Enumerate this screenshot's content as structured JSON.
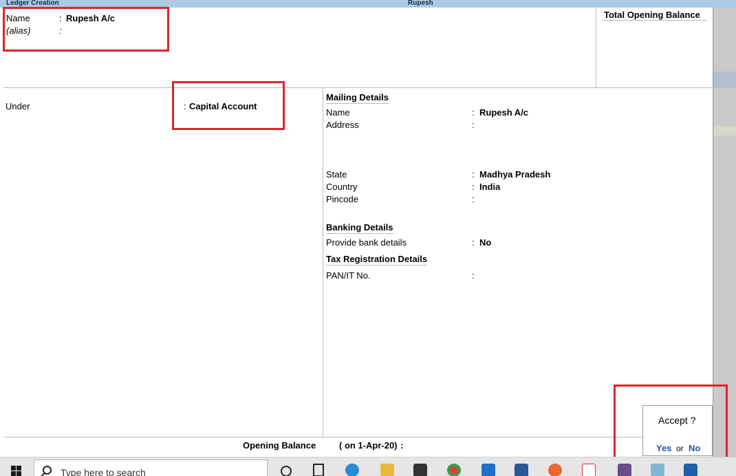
{
  "window": {
    "title": "Ledger Creation",
    "company": "Rupesh"
  },
  "ledger": {
    "name_label": "Name",
    "name_value": "Rupesh A/c",
    "alias_label": "(alias)",
    "under_label": "Under",
    "under_value": "Capital Account",
    "colon": ":"
  },
  "total_opening_balance": {
    "label": "Total Opening Balance"
  },
  "mailing": {
    "heading": "Mailing Details",
    "name_label": "Name",
    "name_value": "Rupesh A/c",
    "address_label": "Address",
    "state_label": "State",
    "state_value": "Madhya Pradesh",
    "country_label": "Country",
    "country_value": "India",
    "pincode_label": "Pincode"
  },
  "banking": {
    "heading": "Banking Details",
    "provide_label": "Provide bank details",
    "provide_value": "No"
  },
  "tax": {
    "heading": "Tax Registration Details",
    "pan_label": "PAN/IT No."
  },
  "opening_balance": {
    "label": "Opening Balance",
    "date": "( on 1-Apr-20)",
    "colon": ":"
  },
  "dialog": {
    "question": "Accept ?",
    "yes": "Yes",
    "or": "or",
    "no": "No"
  },
  "taskbar": {
    "search_placeholder": "Type here to search",
    "icons": [
      "windows-start-icon",
      "search-icon",
      "cortana-icon",
      "task-view-icon",
      "edge-icon",
      "file-explorer-icon",
      "store-icon",
      "chrome-icon",
      "mail-icon",
      "word-icon",
      "firefox-icon",
      "pdf-icon",
      "winrar-icon",
      "notepad-icon",
      "tally-icon"
    ]
  },
  "colors": {
    "highlight_red": "#e0242b",
    "title_bar": "#a9cbe4",
    "dialog_link": "#1f5aa8"
  }
}
